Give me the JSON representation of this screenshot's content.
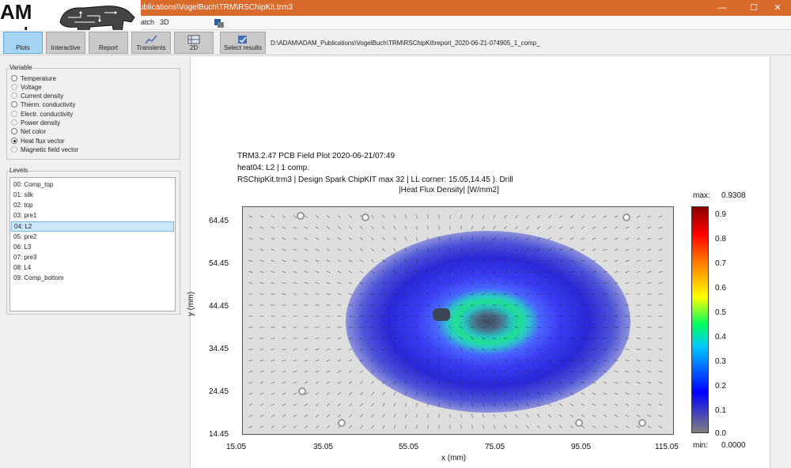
{
  "window": {
    "title": "ublications\\VogelBuch\\TRM\\RSChipKit.trm3",
    "controls": {
      "minimize": "—",
      "maximize": "☐",
      "close": "✕"
    }
  },
  "logo": {
    "line1": "AM",
    "line2": "arch"
  },
  "menu": {
    "item1": "atch",
    "item2": "3D"
  },
  "toolbar": {
    "buttons": [
      {
        "label": "Plots",
        "icon": "plots-icon"
      },
      {
        "label": "Interactive",
        "icon": "interactive-icon"
      },
      {
        "label": "Report",
        "icon": "report-icon"
      },
      {
        "label": "Transients",
        "icon": "transients-icon"
      },
      {
        "label": "2D",
        "icon": "2d-icon"
      },
      {
        "label": "Select results",
        "icon": "select-results-icon"
      }
    ],
    "path": "D:\\ADAM\\ADAM_Publications\\VogelBuch\\TRM\\RSChipKit\\report_2020-06-21-074905_1_comp_"
  },
  "variable_group": {
    "title": "Variable",
    "options": [
      {
        "label": "Temperature",
        "enabled": true,
        "selected": false
      },
      {
        "label": "Voltage",
        "enabled": false,
        "selected": false
      },
      {
        "label": "Current density",
        "enabled": false,
        "selected": false
      },
      {
        "label": "Therm. conductivity",
        "enabled": true,
        "selected": false
      },
      {
        "label": "Electr. conductivity",
        "enabled": false,
        "selected": false
      },
      {
        "label": "Power density",
        "enabled": false,
        "selected": false
      },
      {
        "label": "Net color",
        "enabled": true,
        "selected": false
      },
      {
        "label": "Heat flux vector",
        "enabled": true,
        "selected": true
      },
      {
        "label": "Magnetic field vector",
        "enabled": false,
        "selected": false
      }
    ]
  },
  "levels_group": {
    "title": "Levels",
    "items": [
      "00: Comp_top",
      "01: silk",
      "02: top",
      "03: pre1",
      "04: L2",
      "05: pre2",
      "06: L3",
      "07: pre3",
      "08: L4",
      "09: Comp_bottom"
    ],
    "selected_index": 4
  },
  "plot": {
    "header1": "TRM3.2.47     PCB Field Plot    2020-06-21/07:49",
    "header2": "heat04: L2  |  1 comp.",
    "header3": "RSChipKit.trm3 | Design Spark ChipKIT max  32 | LL corner: 15.05,14.45 ). Drill",
    "header4": "|Heat Flux Density| [W/mm2]",
    "x_label": "x (mm)",
    "y_label": "y (mm)",
    "x_ticks": [
      "15.05",
      "35.05",
      "55.05",
      "75.05",
      "95.05",
      "115.05"
    ],
    "y_ticks": [
      "64.45",
      "54.45",
      "44.45",
      "34.45",
      "24.45",
      "14.45"
    ],
    "colorbar": {
      "max_label": "max:",
      "max_value": "0.9308",
      "min_label": "min:",
      "min_value": "0.0000",
      "ticks": [
        "0.9",
        "0.8",
        "0.7",
        "0.6",
        "0.5",
        "0.4",
        "0.3",
        "0.2",
        "0.1",
        "0.0"
      ]
    }
  }
}
